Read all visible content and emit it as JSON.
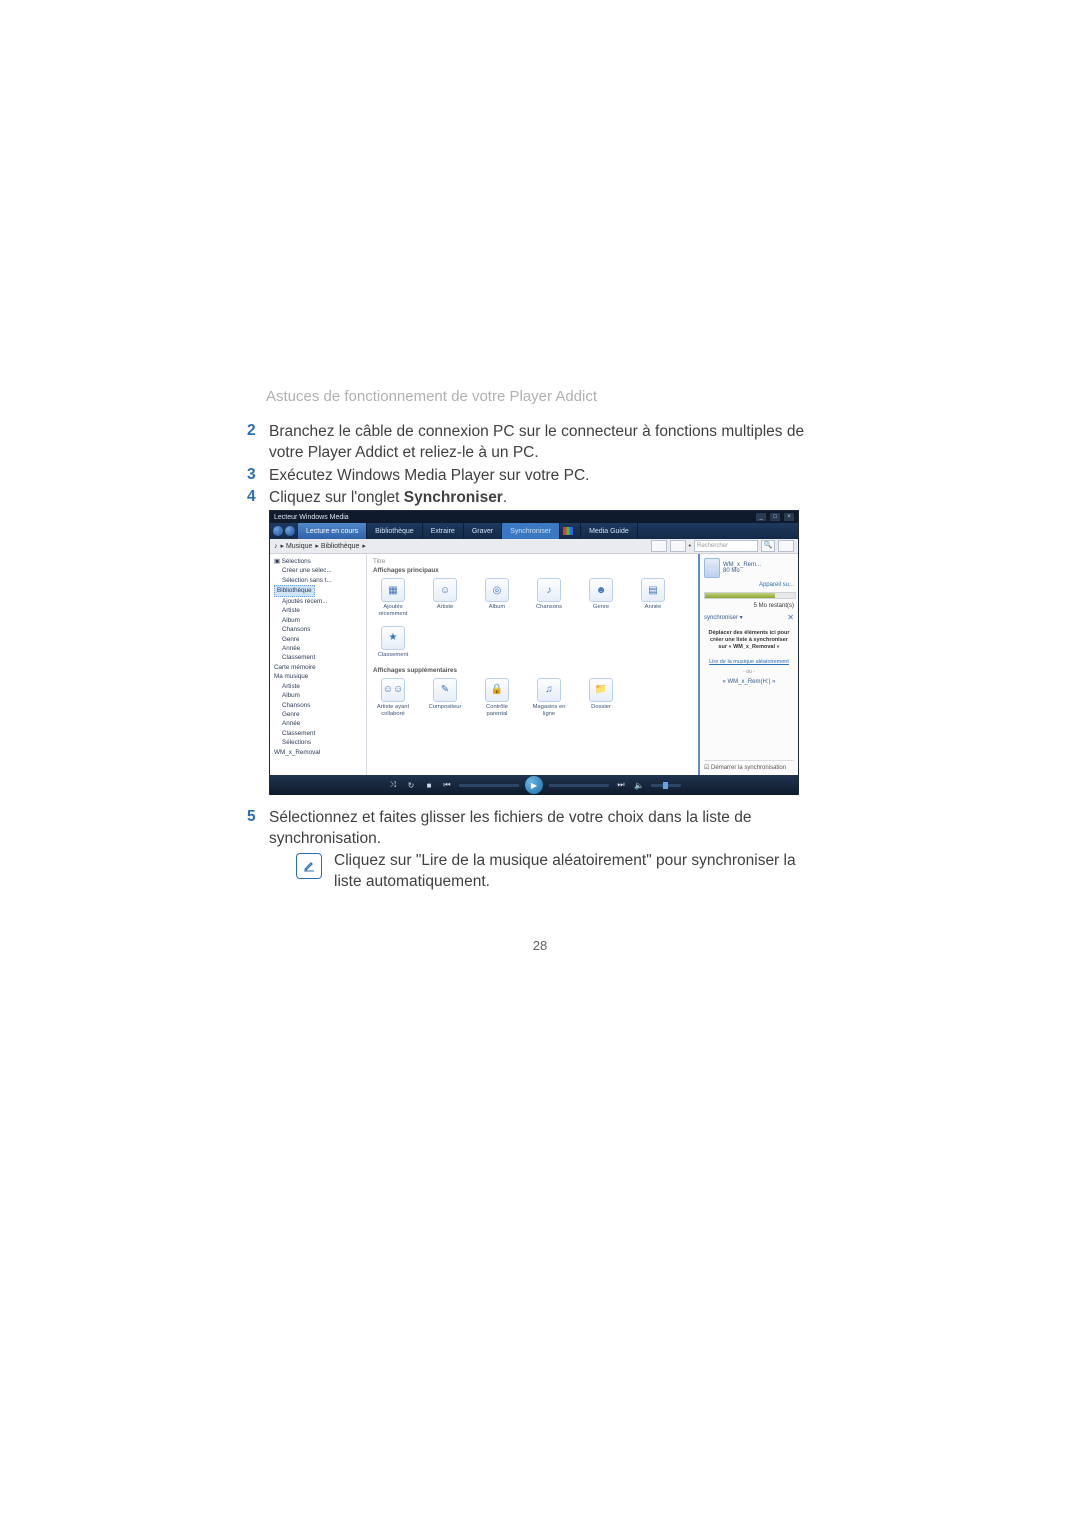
{
  "header": "Astuces de fonctionnement de votre Player Addict",
  "steps": {
    "s2": {
      "num": "2",
      "text": "Branchez le câble de connexion PC sur le connecteur à fonctions multiples de votre Player Addict et reliez-le à un PC."
    },
    "s3": {
      "num": "3",
      "text": "Exécutez Windows Media Player sur votre PC."
    },
    "s4": {
      "num": "4",
      "text_a": "Cliquez sur l'onglet ",
      "text_b": "Synchroniser",
      "text_c": "."
    },
    "s5": {
      "num": "5",
      "text": "Sélectionnez et faites glisser les fichiers de votre choix dans la liste de synchronisation."
    }
  },
  "note": {
    "text": "Cliquez sur \"Lire de la musique aléatoirement\" pour synchroniser la liste automatiquement."
  },
  "page_number": "28",
  "wmp": {
    "title": "Lecteur Windows Media",
    "tabs": {
      "now": "Lecture en cours",
      "lib": "Bibliothèque",
      "extract": "Extraire",
      "burn": "Graver",
      "sync": "Synchroniser",
      "guide": "Media Guide"
    },
    "breadcrumb": {
      "a": "▸ Musique",
      "b": "▸ Bibliothèque",
      "c": "▸",
      "search_ph": "Rechercher"
    },
    "tree": {
      "n0": "▣ Sélections",
      "n1": "Créer une sélec...",
      "n2": "Sélection sans t...",
      "n3": "Bibliothèque",
      "n4": "Ajoutés récem...",
      "n5": "Artiste",
      "n6": "Album",
      "n7": "Chansons",
      "n8": "Genre",
      "n9": "Année",
      "n10": "Classement",
      "n11": "Carte mémoire",
      "n12": "Ma musique",
      "n13": "Artiste",
      "n14": "Album",
      "n15": "Chansons",
      "n16": "Genre",
      "n17": "Année",
      "n18": "Classement",
      "n19": "Sélections",
      "n20": "WM_x_Removal"
    },
    "main": {
      "badge": "Titre",
      "section1": "Affichages principaux",
      "section2": "Affichages supplémentaires",
      "row1": {
        "c0": "Ajoutés récemment",
        "c1": "Artiste",
        "c2": "Album",
        "c3": "Chansons",
        "c4": "Genre",
        "c5": "Année"
      },
      "row1b": {
        "c0": "Classement"
      },
      "row2": {
        "c0": "Artiste ayant collaboré",
        "c1": "Compositeur",
        "c2": "Contrôle parental",
        "c3": "Magasins en ligne",
        "c4": "Dossier"
      }
    },
    "right": {
      "devname": "WM_x_Rem...",
      "devcap": "80 Mo",
      "nextdev": "Appareil su...",
      "remain": "5 Mo restant(s)",
      "synclabel": "synchroniser ▾",
      "drop": "Déplacer des éléments ici pour créer une liste à synchroniser sur « WM_x_Removal »",
      "random": "Lire de la musique aléatoirement",
      "or": "- ou -",
      "alt": "« WM_x_Rem(H:) »",
      "start": "☑ Démarrer la synchronisation"
    },
    "controls": {
      "shuffle": "⤨",
      "repeat": "↻",
      "stop": "■",
      "prev": "⏮",
      "play": "▶",
      "next": "⏭",
      "mute": "🔈"
    }
  }
}
